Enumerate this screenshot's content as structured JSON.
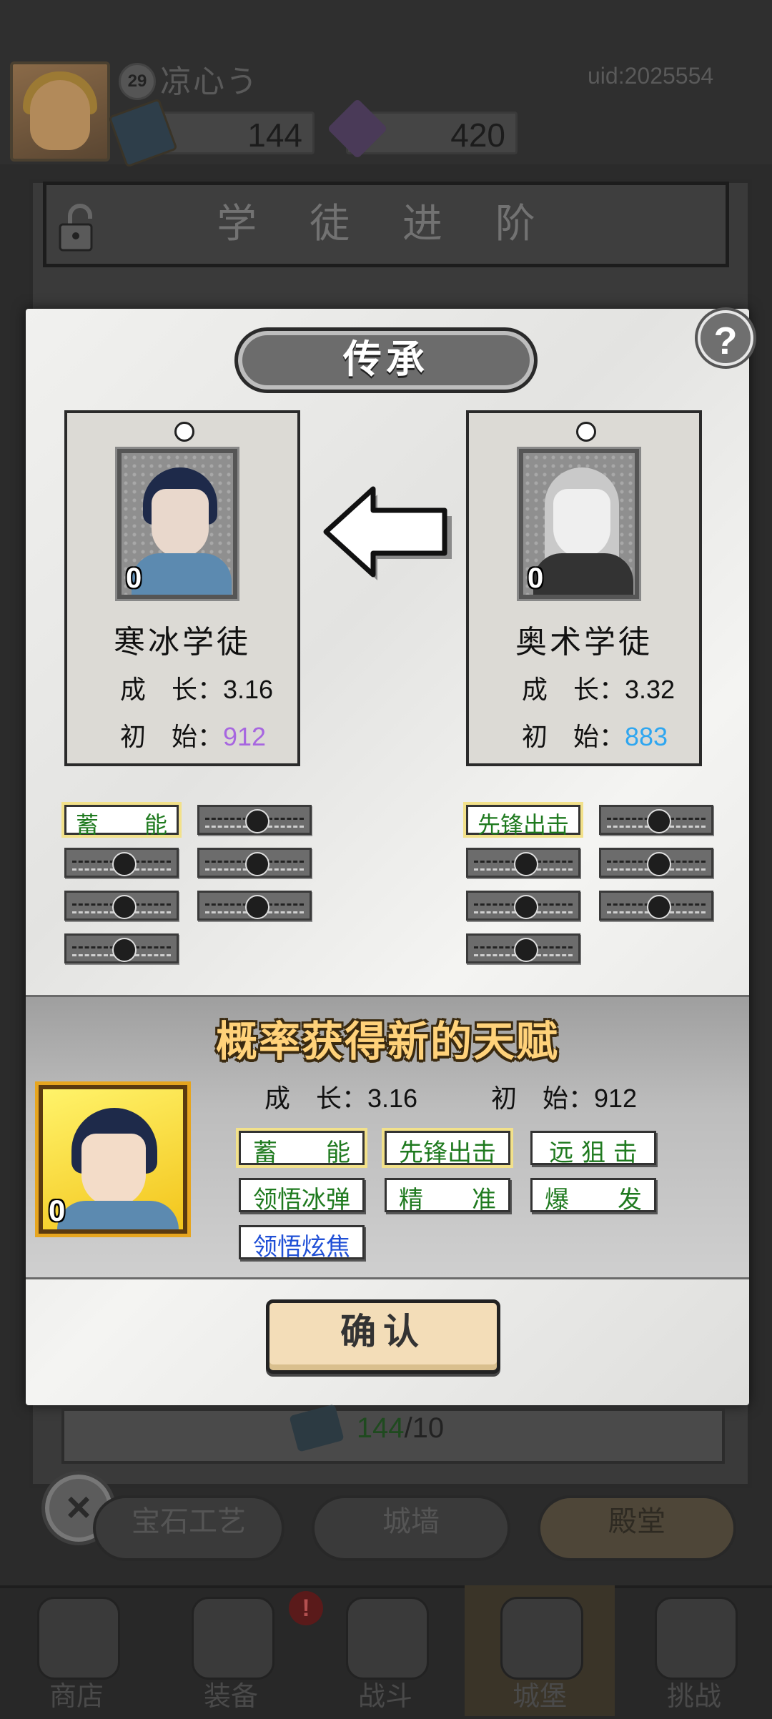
{
  "header": {
    "level": "29",
    "username": "凉心う",
    "uid": "uid:2025554",
    "books": "144",
    "gems": "420"
  },
  "page_title": "学 徒 进 阶",
  "modal": {
    "title": "传承",
    "help": "?",
    "left_card": {
      "name": "寒冰学徒",
      "level": "0",
      "growth_label": "成　长：",
      "growth": "3.16",
      "initial_label": "初　始：",
      "initial": "912",
      "initial_color": "#a766e0",
      "talents": [
        "蓄　　能"
      ]
    },
    "right_card": {
      "name": "奥术学徒",
      "level": "0",
      "growth_label": "成　长：",
      "growth": "3.32",
      "initial_label": "初　始：",
      "initial": "883",
      "initial_color": "#2ea6f0",
      "talents": [
        "先锋出击"
      ]
    },
    "result": {
      "title": "概率获得新的天赋",
      "level": "0",
      "growth_label": "成　长：",
      "growth": "3.16",
      "initial_label": "初　始：",
      "initial": "912",
      "talents": [
        {
          "label": "蓄　　能",
          "color": "green"
        },
        {
          "label": "先锋出击",
          "color": "green"
        },
        {
          "label": "远 狙 击",
          "color": "green"
        },
        {
          "label": "领悟冰弹",
          "color": "green"
        },
        {
          "label": "精　　准",
          "color": "green"
        },
        {
          "label": "爆　　发",
          "color": "green"
        },
        {
          "label": "领悟炫焦",
          "color": "blue"
        }
      ]
    },
    "confirm": "确认"
  },
  "bottom": {
    "count_have": "144",
    "count_need": "/10",
    "tabs": [
      "宝石工艺",
      "城墙",
      "殿堂"
    ],
    "close": "×"
  },
  "nav": {
    "items": [
      "商店",
      "装备",
      "战斗",
      "城堡",
      "挑战"
    ],
    "badge": "!"
  }
}
